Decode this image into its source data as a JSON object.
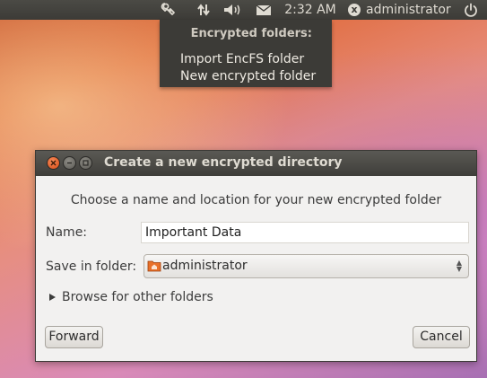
{
  "panel": {
    "time": "2:32 AM",
    "user": "administrator",
    "user_badge": "x",
    "icons": [
      "encfs-indicator-icon",
      "network-icon",
      "volume-icon",
      "mail-icon",
      "session-icon",
      "power-icon"
    ]
  },
  "indicator_menu": {
    "header": "Encrypted folders:",
    "items": [
      "Import EncFS folder",
      "New encrypted folder"
    ]
  },
  "dialog": {
    "title": "Create a new encrypted directory",
    "instruction": "Choose a name and location for your new encrypted folder",
    "name_label": "Name:",
    "name_value": "Important Data",
    "save_label": "Save in folder:",
    "folder_value": "administrator",
    "browse_label": "Browse for other folders",
    "forward_label": "Forward",
    "cancel_label": "Cancel"
  },
  "colors": {
    "panel_bg": "#3c3b37",
    "panel_text": "#dfdbd2",
    "close_button": "#e05a20",
    "dialog_bg": "#f2f1f0"
  }
}
